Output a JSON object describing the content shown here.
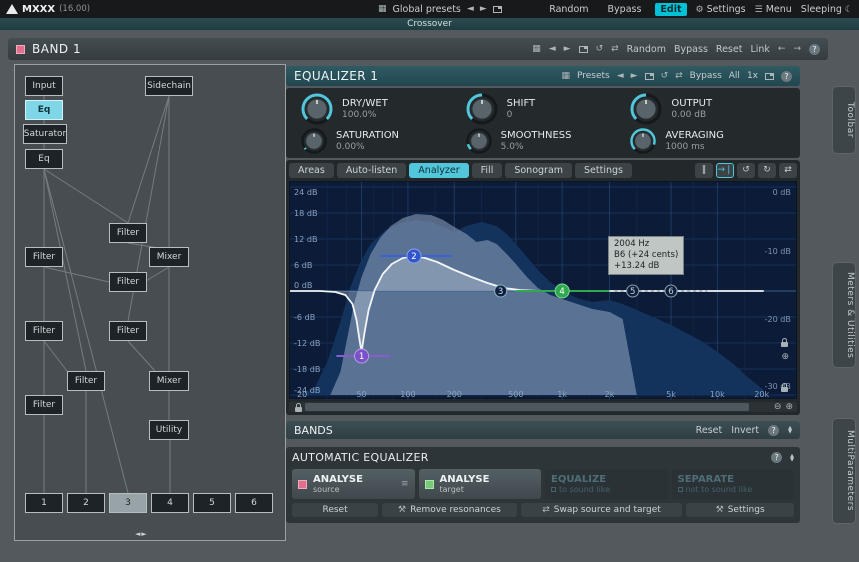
{
  "colors": {
    "accent": "#52c6da",
    "band_pink": "#e0708c",
    "target_green": "#78c878",
    "node_purple": "#7a52c8",
    "node_blue": "#3355cc",
    "node_green": "#2fa84e"
  },
  "topbar": {
    "app_name": "MXXX",
    "version": "(16.00)",
    "global_presets": "Global presets",
    "random": "Random",
    "bypass": "Bypass",
    "edit": "Edit",
    "settings": "Settings",
    "menu": "Menu",
    "sleeping": "Sleeping"
  },
  "crossover_label": "Crossover",
  "band_header": {
    "title": "BAND 1",
    "random": "Random",
    "bypass": "Bypass",
    "reset": "Reset",
    "link": "Link",
    "help": "?"
  },
  "node_graph": {
    "input": "Input",
    "sidechain": "Sidechain",
    "eq": "Eq",
    "saturator": "Saturator",
    "filter": "Filter",
    "mixer": "Mixer",
    "utility": "Utility",
    "outputs": [
      "1",
      "2",
      "3",
      "4",
      "5",
      "6"
    ]
  },
  "equalizer": {
    "title": "EQUALIZER 1",
    "presets_label": "Presets",
    "bypass": "Bypass",
    "all": "All",
    "scale": "1x",
    "help": "?",
    "knobs": [
      {
        "label": "DRY/WET",
        "value": "100.0%"
      },
      {
        "label": "SHIFT",
        "value": "0"
      },
      {
        "label": "OUTPUT",
        "value": "0.00 dB"
      },
      {
        "label": "SATURATION",
        "value": "0.00%"
      },
      {
        "label": "SMOOTHNESS",
        "value": "5.0%"
      },
      {
        "label": "AVERAGING",
        "value": "1000 ms"
      }
    ],
    "analyzer_tabs": [
      "Areas",
      "Auto-listen",
      "Analyzer",
      "Fill",
      "Sonogram",
      "Settings"
    ],
    "active_tab": "Analyzer",
    "graph": {
      "db_ticks": [
        "24 dB",
        "18 dB",
        "12 dB",
        "6 dB",
        "0 dB",
        "-6 dB",
        "-12 dB",
        "-18 dB",
        "-24 dB"
      ],
      "right_db_ticks": [
        "0 dB",
        "-10 dB",
        "-20 dB",
        "-30 dB"
      ],
      "freq_ticks": [
        "20",
        "50",
        "100",
        "200",
        "500",
        "1k",
        "2k",
        "5k",
        "10k",
        "20k"
      ],
      "tooltip": [
        "2004 Hz",
        "B6 (+24 cents)",
        "+13.24 dB"
      ],
      "bands": [
        {
          "id": "1",
          "freq": "46 Hz",
          "gain": "-15.0 dB"
        },
        {
          "id": "2",
          "freq": "110 Hz",
          "gain": "+8.0 dB"
        },
        {
          "id": "3",
          "freq": "400 Hz",
          "gain": "0.0 dB"
        },
        {
          "id": "4",
          "freq": "1000 Hz",
          "gain": "0.0 dB"
        },
        {
          "id": "5",
          "freq": "2900 Hz",
          "gain": "0.0 dB"
        },
        {
          "id": "6",
          "freq": "5500 Hz",
          "gain": "0.0 dB"
        }
      ]
    }
  },
  "bands_section": {
    "title": "BANDS",
    "reset": "Reset",
    "invert": "Invert",
    "help": "?"
  },
  "auto_eq": {
    "title": "AUTOMATIC EQUALIZER",
    "help": "?",
    "buttons": [
      {
        "title": "ANALYSE",
        "subtitle": "source"
      },
      {
        "title": "ANALYSE",
        "subtitle": "target"
      },
      {
        "title": "EQUALIZE",
        "subtitle": "to sound like"
      },
      {
        "title": "SEPARATE",
        "subtitle": "not to sound like"
      }
    ],
    "actions": [
      "Reset",
      "Remove resonances",
      "Swap source and target",
      "Settings"
    ]
  },
  "side_tabs": [
    "Toolbar",
    "Meters & Utilities",
    "MultiParameters"
  ]
}
